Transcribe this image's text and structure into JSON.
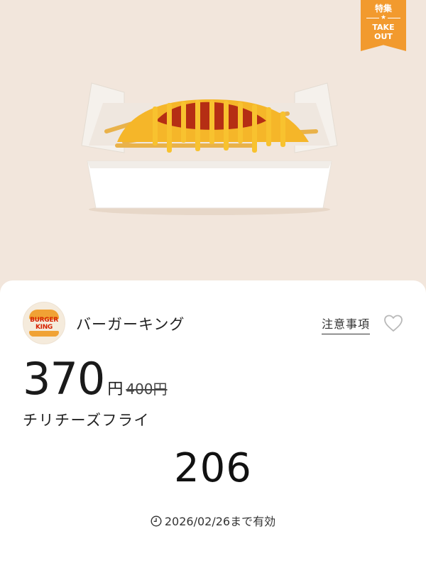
{
  "tag": {
    "top": "特集",
    "divider": "★",
    "bottom": "TAKE\nOUT",
    "color": "#f29a2e"
  },
  "brand": {
    "logo_text": "BURGER\nKING",
    "name": "バーガーキング"
  },
  "notice_label": "注意事項",
  "favorite_icon": "heart-outline-icon",
  "price": {
    "current": "370",
    "unit": "円",
    "original": "400円"
  },
  "product_name": "チリチーズフライ",
  "coupon_code": "206",
  "expiry": {
    "icon": "clock-icon",
    "text": "2026/02/26まで有効"
  }
}
